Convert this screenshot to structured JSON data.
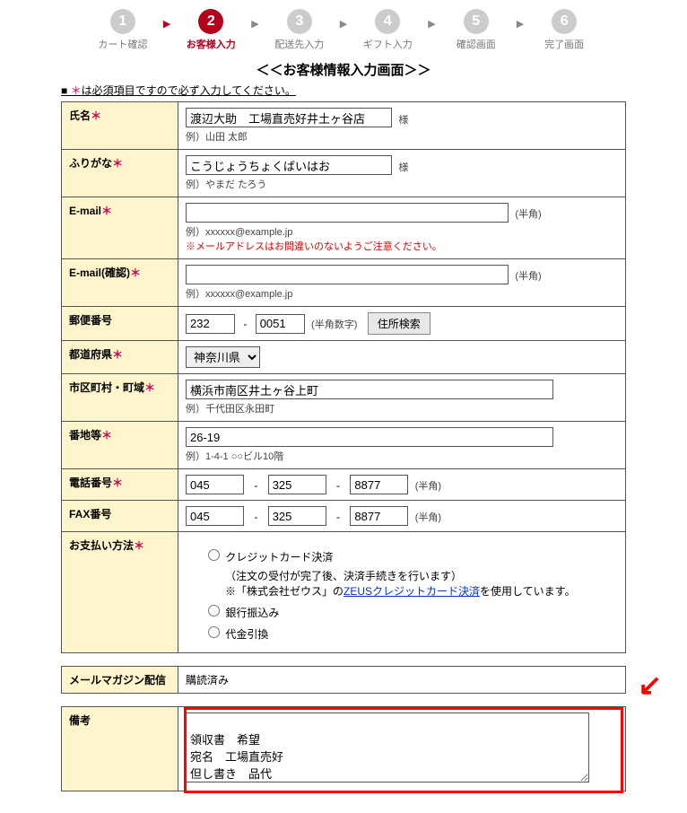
{
  "steps": [
    {
      "num": "1",
      "label": "カート確認"
    },
    {
      "num": "2",
      "label": "お客様入力"
    },
    {
      "num": "3",
      "label": "配送先入力"
    },
    {
      "num": "4",
      "label": "ギフト入力"
    },
    {
      "num": "5",
      "label": "確認画面"
    },
    {
      "num": "6",
      "label": "完了画面"
    }
  ],
  "active_step_index": 1,
  "heading": "＜＜お客様情報入力画面＞＞",
  "note_prefix": "■ ",
  "note_req": "＊",
  "note_rest": "は必須項目ですので必ず入力してください。",
  "required_mark": "＊",
  "fields": {
    "name": {
      "label": "氏名",
      "value": "渡辺大助　工場直売好井土ヶ谷店",
      "suffix": "様",
      "example": "例）山田 太郎"
    },
    "furigana": {
      "label": "ふりがな",
      "value": "こうじょうちょくばいはお",
      "suffix": "様",
      "example": "例）やまだ たろう"
    },
    "email": {
      "label": "E-mail",
      "value": "",
      "suffix": "(半角)",
      "example": "例）xxxxxx@example.jp",
      "warn": "※メールアドレスはお間違いのないようご注意ください。"
    },
    "email_confirm": {
      "label": "E-mail(確認)",
      "value": "",
      "suffix": "(半角)",
      "example": "例）xxxxxx@example.jp"
    },
    "postal": {
      "label": "郵便番号",
      "p1": "232",
      "sep": "-",
      "p2": "0051",
      "suffix": "(半角数字)",
      "button": "住所検索"
    },
    "pref": {
      "label": "都道府県",
      "value": "神奈川県"
    },
    "city": {
      "label": "市区町村・町域",
      "value": "横浜市南区井土ヶ谷上町",
      "example": "例）千代田区永田町"
    },
    "street": {
      "label": "番地等",
      "value": "26-19",
      "example": "例）1-4-1 ○○ビル10階"
    },
    "tel": {
      "label": "電話番号",
      "p1": "045",
      "p2": "325",
      "p3": "8877",
      "sep": "-",
      "suffix": "(半角)"
    },
    "fax": {
      "label": "FAX番号",
      "p1": "045",
      "p2": "325",
      "p3": "8877",
      "sep": "-",
      "suffix": "(半角)"
    },
    "payment": {
      "label": "お支払い方法",
      "opt1": "クレジットカード決済",
      "opt1_sub1": "（注文の受付が完了後、決済手続きを行います）",
      "opt1_sub2a": "※「株式会社ゼウス」の",
      "opt1_sub2_link": "ZEUSクレジットカード決済",
      "opt1_sub2b": "を使用しています。",
      "opt2": "銀行振込み",
      "opt3": "代金引換"
    }
  },
  "mailmag": {
    "label": "メールマガジン配信",
    "value": "購読済み"
  },
  "remarks": {
    "label": "備考",
    "value": "\n領収書　希望\n宛名　工場直売好\n但し書き　品代"
  }
}
